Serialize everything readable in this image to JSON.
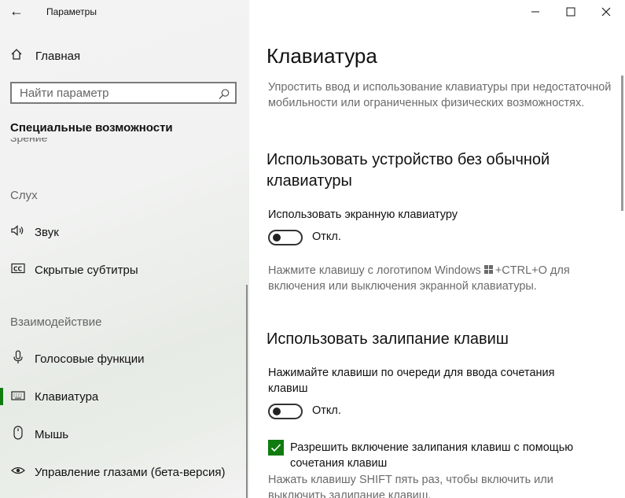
{
  "window": {
    "title": "Параметры",
    "back_icon": "←",
    "minimize_icon": "—",
    "maximize_icon": "☐",
    "close_icon": "✕"
  },
  "sidebar": {
    "home_label": "Главная",
    "search_placeholder": "Найти параметр",
    "section_title": "Специальные возможности",
    "cut_off_item": "Зрение",
    "groups": [
      {
        "header": "Слух",
        "items": [
          {
            "label": "Звук",
            "icon": "speaker-icon"
          },
          {
            "label": "Скрытые субтитры",
            "icon": "closed-captions-icon"
          }
        ]
      },
      {
        "header": "Взаимодействие",
        "items": [
          {
            "label": "Голосовые функции",
            "icon": "microphone-icon"
          },
          {
            "label": "Клавиатура",
            "icon": "keyboard-icon",
            "active": true
          },
          {
            "label": "Мышь",
            "icon": "mouse-icon"
          },
          {
            "label": "Управление глазами (бета-версия)",
            "icon": "eye-control-icon"
          }
        ]
      }
    ]
  },
  "main": {
    "title": "Клавиатура",
    "description": "Упростить ввод и использование клавиатуры при недостаточной мобильности или ограниченных физических возможностях.",
    "section1": {
      "heading": "Использовать устройство без обычной клавиатуры",
      "option_label": "Использовать экранную клавиатуру",
      "toggle_state": "Откл.",
      "hint_before": "Нажмите клавишу с логотипом Windows",
      "hint_after": "+CTRL+O для включения или выключения экранной клавиатуры."
    },
    "section2": {
      "heading": "Использовать залипание клавиш",
      "option_label": "Нажимайте клавиши по очереди для ввода сочетания клавиш",
      "toggle_state": "Откл.",
      "checkbox_label": "Разрешить включение залипания клавиш с помощью сочетания клавиш",
      "checkbox_checked": true,
      "hint": "Нажать клавишу SHIFT пять раз, чтобы включить или выключить залипание клавиш."
    }
  },
  "colors": {
    "accent": "#107c10"
  }
}
